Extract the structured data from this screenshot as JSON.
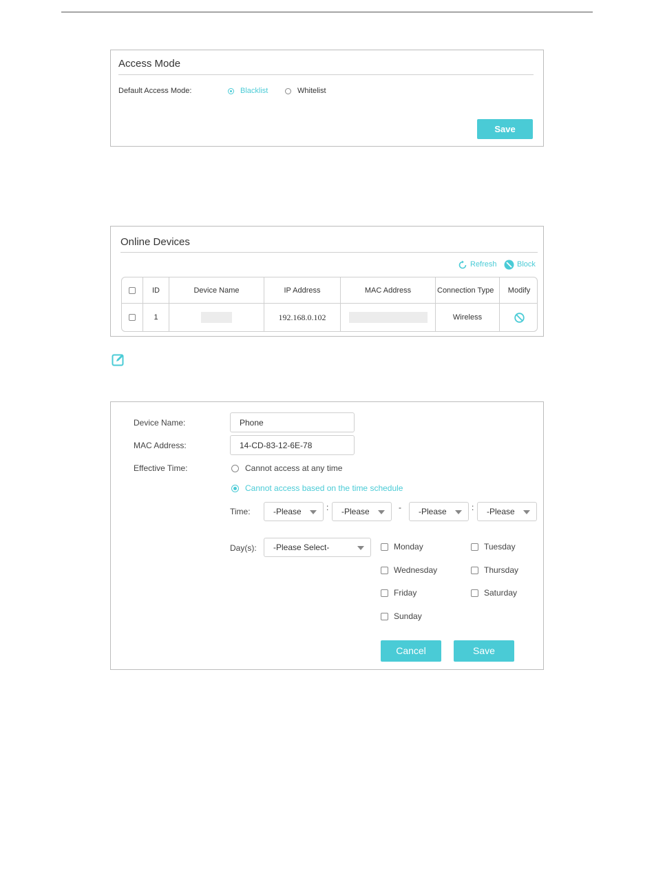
{
  "colors": {
    "accent": "#4acbd6",
    "border": "#bcbcbc"
  },
  "access_mode": {
    "title": "Access Mode",
    "default_label": "Default Access Mode:",
    "options": [
      {
        "label": "Blacklist",
        "selected": true
      },
      {
        "label": "Whitelist",
        "selected": false
      }
    ],
    "save_label": "Save"
  },
  "online_devices": {
    "title": "Online Devices",
    "refresh_label": "Refresh",
    "refresh_icon": "refresh-icon",
    "block_label": "Block",
    "block_icon": "block-icon",
    "columns": [
      "ID",
      "Device Name",
      "IP Address",
      "MAC Address",
      "Connection Type",
      "Modify"
    ],
    "rows": [
      {
        "id": "1",
        "device_name": "",
        "ip": "192.168.0.102",
        "mac": "",
        "connection": "Wireless",
        "modify_icon": "block-icon"
      }
    ]
  },
  "note_icon": "note-edit-icon",
  "modify_form": {
    "device_name_label": "Device Name:",
    "device_name_value": "Phone",
    "mac_label": "MAC Address:",
    "mac_value": "14-CD-83-12-6E-78",
    "effective_time_label": "Effective Time:",
    "time_options": [
      {
        "label": "Cannot access at any time",
        "selected": false
      },
      {
        "label": "Cannot access based on the time schedule",
        "selected": true
      }
    ],
    "time_label": "Time:",
    "time_selects": [
      "-Please",
      "-Please",
      "-Please",
      "-Please"
    ],
    "colon": ":",
    "dash": "-",
    "days_label": "Day(s):",
    "days_select": "-Please Select-",
    "days": [
      "Monday",
      "Tuesday",
      "Wednesday",
      "Thursday",
      "Friday",
      "Saturday",
      "Sunday"
    ],
    "cancel_label": "Cancel",
    "save_label": "Save"
  }
}
